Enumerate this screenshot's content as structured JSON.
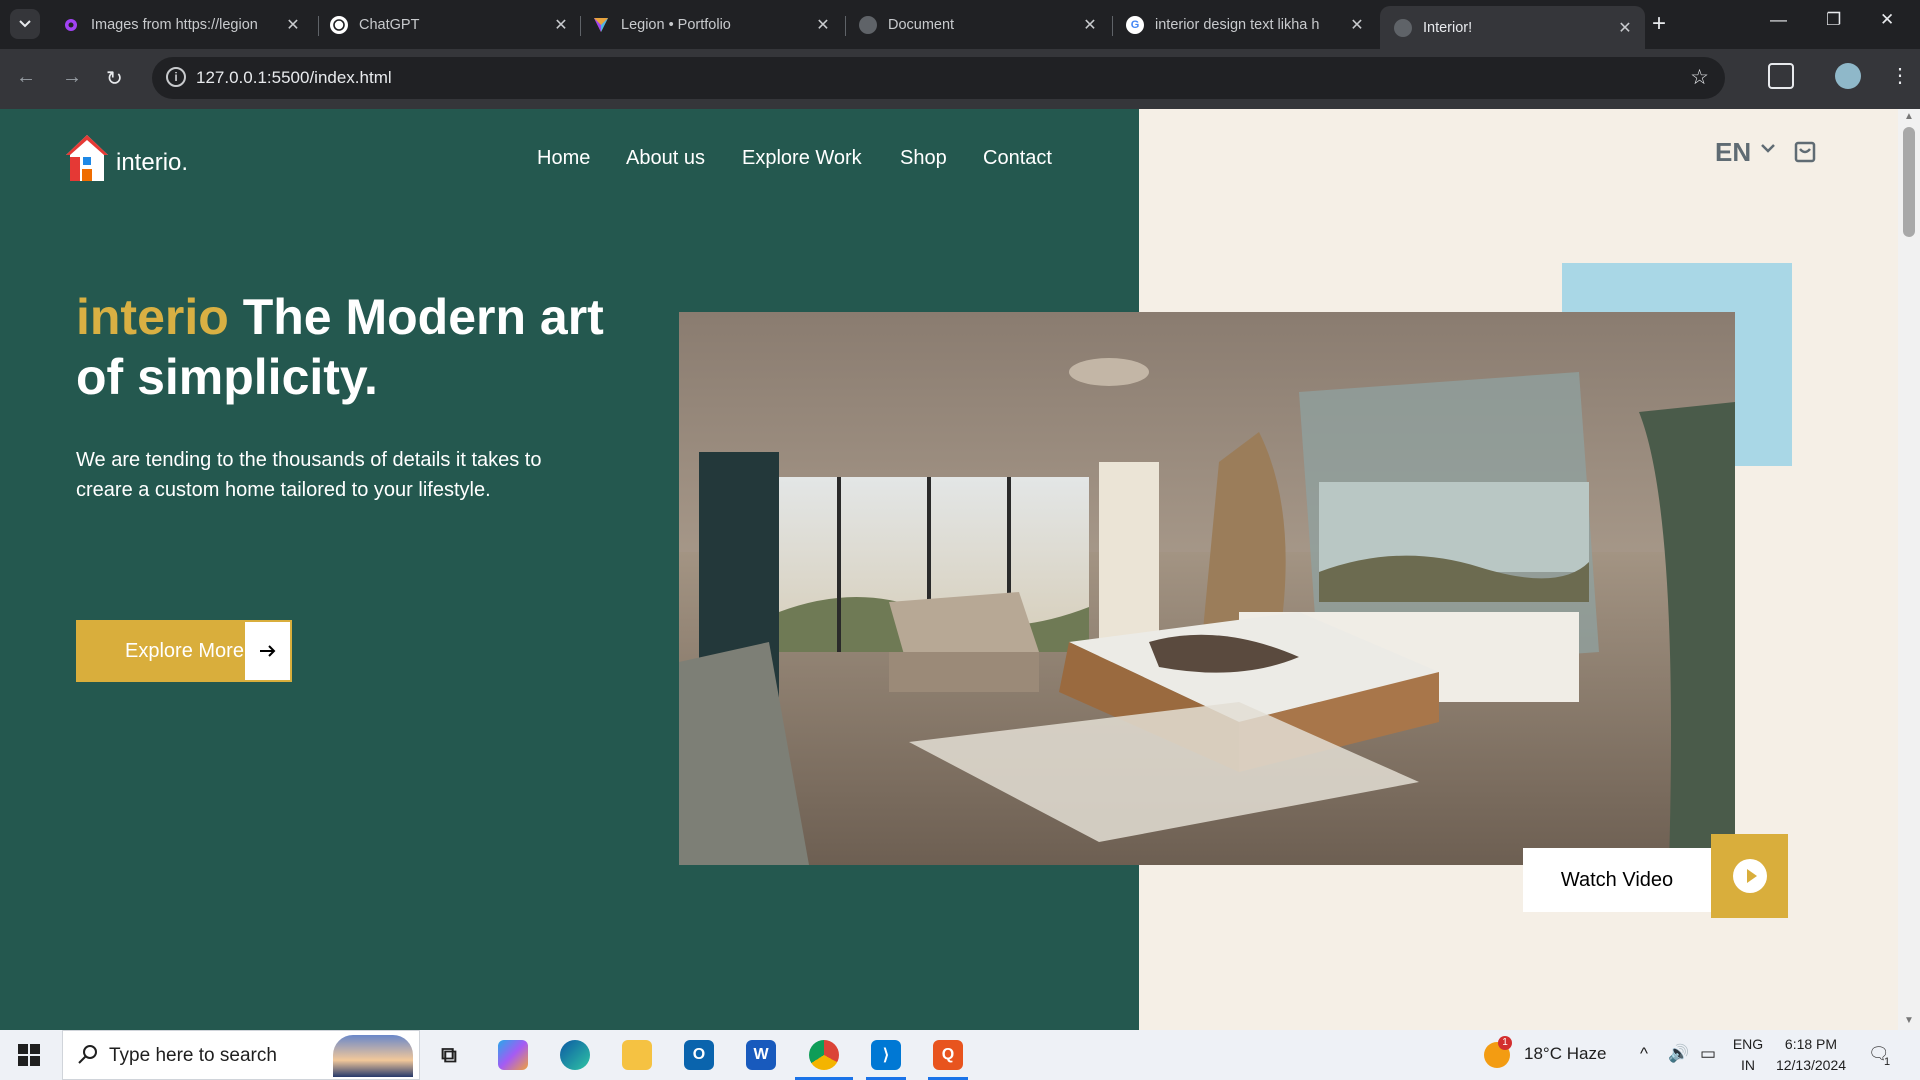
{
  "browser": {
    "tabs": [
      {
        "title": "Images from https://legion",
        "favicon": "gear-favicon",
        "favicon_color": "#a142f4"
      },
      {
        "title": "ChatGPT",
        "favicon": "chatgpt-favicon",
        "favicon_color": "#ffffff"
      },
      {
        "title": "Legion • Portfolio",
        "favicon": "legion-favicon",
        "favicon_color": "#e8a33d"
      },
      {
        "title": "Document",
        "favicon": "globe-favicon",
        "favicon_color": "#5f6368"
      },
      {
        "title": "interior design text likha h",
        "favicon": "google-favicon",
        "favicon_color": "#ffffff"
      },
      {
        "title": "Interior!",
        "favicon": "globe-favicon",
        "favicon_color": "#5f6368",
        "active": true
      }
    ],
    "url": "127.0.0.1:5500/index.html"
  },
  "site": {
    "logo_text": "interio.",
    "nav": [
      "Home",
      "About us",
      "Explore Work",
      "Shop",
      "Contact"
    ],
    "language": "EN",
    "hero": {
      "title_accent": "interio",
      "title_rest": " The Modern art of simplicity.",
      "description": "We are tending to the thousands of details it takes to creare a custom home tailored to your lifestyle.",
      "cta_label": "Explore More",
      "watch_label": "Watch Video"
    },
    "colors": {
      "green": "#24584f",
      "gold": "#d9ae3c",
      "cream": "#f5efe6",
      "blue": "#a9d7e6"
    }
  },
  "taskbar": {
    "search_placeholder": "Type here to search",
    "weather": "18°C  Haze",
    "weather_badge": "1",
    "lang_top": "ENG",
    "lang_bottom": "IN",
    "time": "6:18 PM",
    "date": "12/13/2024",
    "notification_count": "1"
  }
}
